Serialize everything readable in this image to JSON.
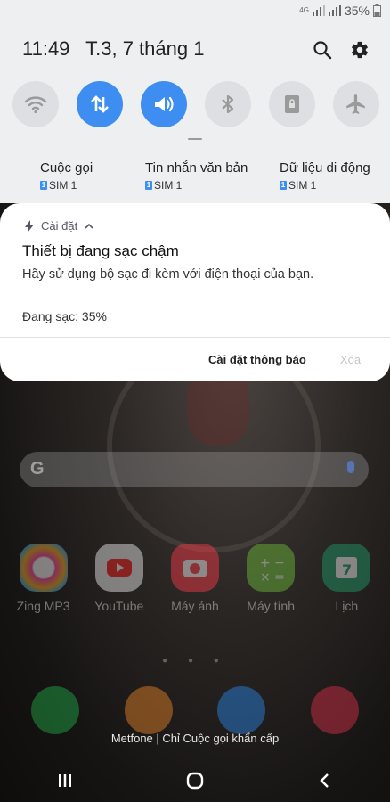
{
  "status_bar": {
    "network": "4G",
    "battery": "35%"
  },
  "header": {
    "time": "11:49",
    "date": "T.3, 7 tháng 1"
  },
  "toggles": [
    {
      "name": "wifi",
      "on": false
    },
    {
      "name": "mobile-data",
      "on": true
    },
    {
      "name": "sound",
      "on": true
    },
    {
      "name": "bluetooth",
      "on": false
    },
    {
      "name": "auto-rotate-lock",
      "on": false
    },
    {
      "name": "airplane",
      "on": false
    }
  ],
  "sim_settings": [
    {
      "title": "Cuộc gọi",
      "sim": "SIM 1"
    },
    {
      "title": "Tin nhắn văn bản",
      "sim": "SIM 1"
    },
    {
      "title": "Dữ liệu di động",
      "sim": "SIM 1"
    }
  ],
  "sim_badge": "1",
  "notification": {
    "app": "Cài đặt",
    "title": "Thiết bị đang sạc chậm",
    "body": "Hãy sử dụng bộ sạc đi kèm với điện thoại của bạn.",
    "charging": "Đang sạc: 35%",
    "action_settings": "Cài đặt thông báo",
    "action_clear": "Xóa"
  },
  "home": {
    "search_logo": "G",
    "apps": [
      {
        "label": "Zing MP3",
        "color": "#ff4aa0"
      },
      {
        "label": "YouTube",
        "color": "#ff2222"
      },
      {
        "label": "Máy ảnh",
        "color": "#ff3a4a"
      },
      {
        "label": "Máy tính",
        "color": "#6fc23a"
      },
      {
        "label": "Lịch",
        "color": "#1fa06a"
      }
    ],
    "dock": [
      {
        "name": "phone",
        "color": "#22b04a"
      },
      {
        "name": "contacts",
        "color": "#f08a2a"
      },
      {
        "name": "messages",
        "color": "#2a8af0"
      },
      {
        "name": "gallery",
        "color": "#e0304a"
      }
    ],
    "carrier": "Metfone | Chỉ Cuộc gọi khẩn cấp"
  },
  "colors": {
    "accent": "#3d8ef0",
    "panel_bg": "#eeeff1"
  }
}
